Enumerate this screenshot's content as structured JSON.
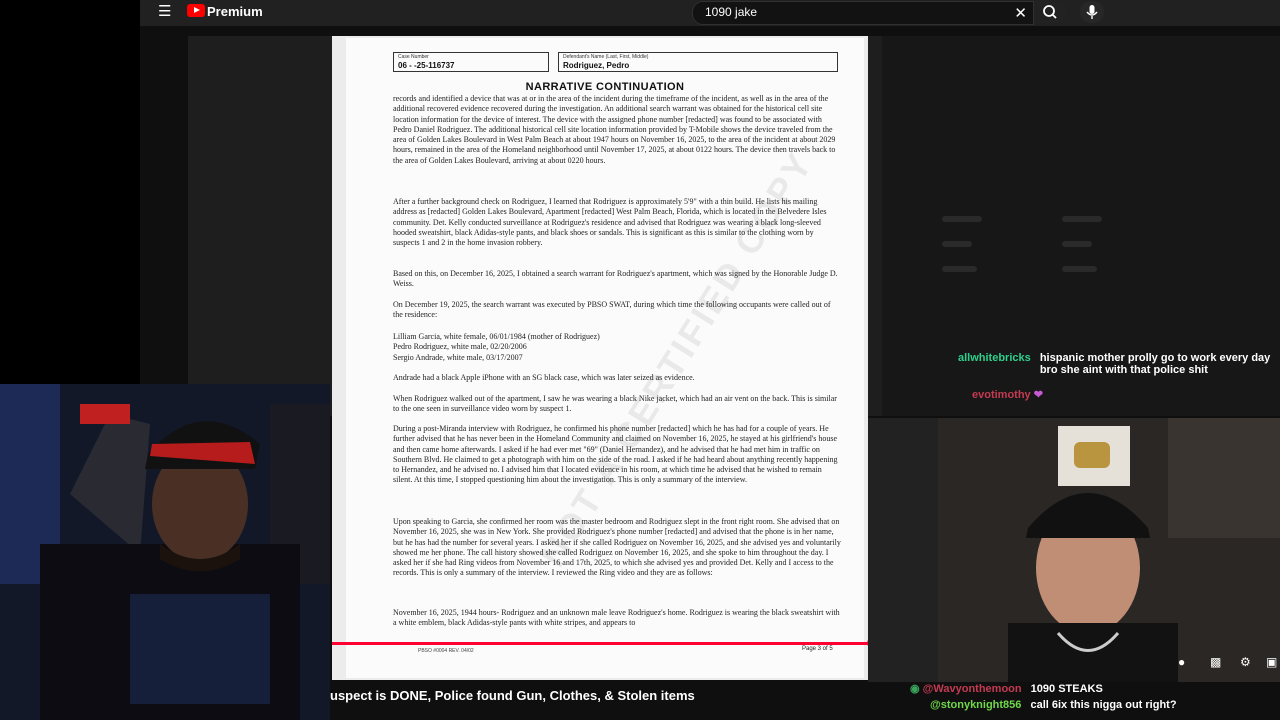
{
  "header": {
    "brand": "Premium",
    "search_value": "1090 jake"
  },
  "document": {
    "case_number_label": "Case Number",
    "case_number": "06 - -25-116737",
    "defendant_label": "Defendant's Name (Last, First, Middle)",
    "defendant": "Rodriguez, Pedro",
    "title": "NARRATIVE CONTINUATION",
    "paragraphs": [
      "records and identified a device that was at or in the area of the incident during the timeframe of the incident, as well as in the area of the additional recovered evidence recovered during the investigation. An additional search warrant was obtained for the historical cell site location information for the device of interest. The device with the assigned phone number [redacted] was found to be associated with Pedro Daniel Rodriguez. The additional historical cell site location information provided by T-Mobile shows the device traveled from the area of Golden Lakes Boulevard in West Palm Beach at about 1947 hours on November 16, 2025, to the area of the incident at about 2029 hours, remained in the area of the Homeland neighborhood until November 17, 2025, at about 0122 hours. The device then travels back to the area of Golden Lakes Boulevard, arriving at about 0220 hours.",
      "After a further background check on Rodriguez, I learned that Rodriguez is approximately 5'9\" with a thin build. He lists his mailing address as [redacted] Golden Lakes Boulevard, Apartment [redacted] West Palm Beach, Florida, which is located in the Belvedere Isles community. Det. Kelly conducted surveillance at Rodriguez's residence and advised that Rodriguez was wearing a black long-sleeved hooded sweatshirt, black Adidas-style pants, and black shoes or sandals. This is significant as this is similar to the clothing worn by suspects 1 and 2 in the home invasion robbery.",
      "Based on this, on December 16, 2025, I obtained a search warrant for Rodriguez's apartment, which was signed by the Honorable Judge D. Weiss.",
      "On December 19, 2025, the search warrant was executed by PBSO SWAT, during which time the following occupants were called out of the residence:",
      "Lilliam Garcia, white female, 06/01/1984 (mother of Rodriguez)\nPedro Rodriguez, white male, 02/20/2006\nSergio Andrade, white male, 03/17/2007",
      "Andrade had a black Apple iPhone with an SG black case, which was later seized as evidence.",
      "When Rodriguez walked out of the apartment, I saw he was wearing a black Nike jacket, which had an air vent on the back. This is similar to the one seen in surveillance video worn by suspect 1.",
      "During a post-Miranda interview with Rodriguez, he confirmed his phone number [redacted] which he has had for a couple of years. He further advised that he has never been in the Homeland Community and claimed on November 16, 2025, he stayed at his girlfriend's house and then came home afterwards. I asked if he had ever met \"69\" (Daniel Hernandez), and he advised that he had met him in traffic on Southern Blvd. He claimed to get a photograph with him on the side of the road. I asked if he had heard about anything recently happening to Hernandez, and he advised no. I advised him that I located evidence in his room, at which time he advised that he wished to remain silent. At this time, I stopped questioning him about the investigation. This is only a summary of the interview.",
      "Upon speaking to Garcia, she confirmed her room was the master bedroom and Rodriguez slept in the front right room. She advised that on November 16, 2025, she was in New York. She provided Rodriguez's phone number [redacted] and advised that the phone is in her name, but he has had the number for several years. I asked her if she called Rodriguez on November 16, 2025, and she advised yes and voluntarily showed me her phone. The call history showed she called Rodriguez on November 16, 2025, and she spoke to him throughout the day. I asked her if she had Ring videos from November 16 and 17th, 2025, to which she advised yes and provided Det. Kelly and I access to the records. This is only a summary of the interview. I reviewed the Ring video and they are as follows:",
      "November 16, 2025, 1944 hours- Rodriguez and an unknown male leave Rodriguez's home. Rodriguez is wearing the black sweatshirt with a white emblem, black Adidas-style pants with white stripes, and appears to"
    ],
    "watermark": "NOT A CERTIFIED COPY",
    "footer_form": "PBSO #0004 REV. 04/02",
    "footer_page": "Page 3 of 5"
  },
  "video": {
    "progress": 0.925,
    "title": "uspect is DONE, Police found Gun, Clothes, & Stolen items"
  },
  "chat": [
    {
      "user": "allwhitebricks",
      "message": "hispanic mother prolly go to work every day bro she aint with that police shit",
      "color": "#2ecf8c"
    },
    {
      "user": "evotimothy",
      "message": "",
      "color": "#c43a52"
    },
    {
      "user": "@Wavyonthemoon",
      "message": "1090 STEAKS",
      "color": "#c43a52"
    },
    {
      "user": "@stonyknight856",
      "message": "call 6ix this nigga out right?",
      "color": "#6fd94a"
    }
  ],
  "colors": {
    "accent": "#ff0033",
    "youtube_red": "#ff0000"
  }
}
